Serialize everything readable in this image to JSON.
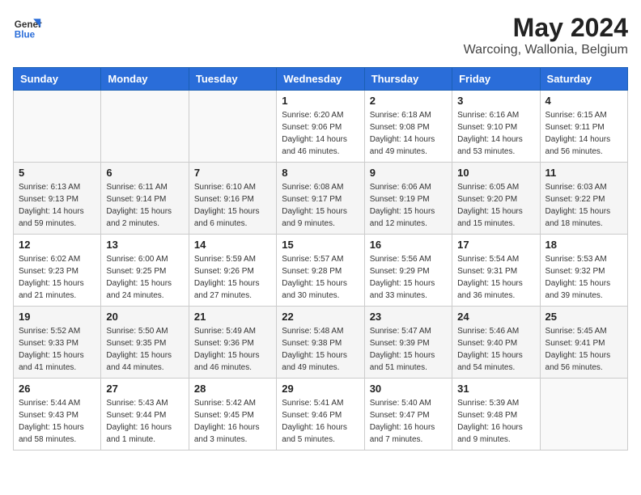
{
  "header": {
    "logo_line1": "General",
    "logo_line2": "Blue",
    "main_title": "May 2024",
    "subtitle": "Warcoing, Wallonia, Belgium"
  },
  "calendar": {
    "headers": [
      "Sunday",
      "Monday",
      "Tuesday",
      "Wednesday",
      "Thursday",
      "Friday",
      "Saturday"
    ],
    "weeks": [
      [
        {
          "day": "",
          "sunrise": "",
          "sunset": "",
          "daylight": ""
        },
        {
          "day": "",
          "sunrise": "",
          "sunset": "",
          "daylight": ""
        },
        {
          "day": "",
          "sunrise": "",
          "sunset": "",
          "daylight": ""
        },
        {
          "day": "1",
          "sunrise": "Sunrise: 6:20 AM",
          "sunset": "Sunset: 9:06 PM",
          "daylight": "Daylight: 14 hours and 46 minutes."
        },
        {
          "day": "2",
          "sunrise": "Sunrise: 6:18 AM",
          "sunset": "Sunset: 9:08 PM",
          "daylight": "Daylight: 14 hours and 49 minutes."
        },
        {
          "day": "3",
          "sunrise": "Sunrise: 6:16 AM",
          "sunset": "Sunset: 9:10 PM",
          "daylight": "Daylight: 14 hours and 53 minutes."
        },
        {
          "day": "4",
          "sunrise": "Sunrise: 6:15 AM",
          "sunset": "Sunset: 9:11 PM",
          "daylight": "Daylight: 14 hours and 56 minutes."
        }
      ],
      [
        {
          "day": "5",
          "sunrise": "Sunrise: 6:13 AM",
          "sunset": "Sunset: 9:13 PM",
          "daylight": "Daylight: 14 hours and 59 minutes."
        },
        {
          "day": "6",
          "sunrise": "Sunrise: 6:11 AM",
          "sunset": "Sunset: 9:14 PM",
          "daylight": "Daylight: 15 hours and 2 minutes."
        },
        {
          "day": "7",
          "sunrise": "Sunrise: 6:10 AM",
          "sunset": "Sunset: 9:16 PM",
          "daylight": "Daylight: 15 hours and 6 minutes."
        },
        {
          "day": "8",
          "sunrise": "Sunrise: 6:08 AM",
          "sunset": "Sunset: 9:17 PM",
          "daylight": "Daylight: 15 hours and 9 minutes."
        },
        {
          "day": "9",
          "sunrise": "Sunrise: 6:06 AM",
          "sunset": "Sunset: 9:19 PM",
          "daylight": "Daylight: 15 hours and 12 minutes."
        },
        {
          "day": "10",
          "sunrise": "Sunrise: 6:05 AM",
          "sunset": "Sunset: 9:20 PM",
          "daylight": "Daylight: 15 hours and 15 minutes."
        },
        {
          "day": "11",
          "sunrise": "Sunrise: 6:03 AM",
          "sunset": "Sunset: 9:22 PM",
          "daylight": "Daylight: 15 hours and 18 minutes."
        }
      ],
      [
        {
          "day": "12",
          "sunrise": "Sunrise: 6:02 AM",
          "sunset": "Sunset: 9:23 PM",
          "daylight": "Daylight: 15 hours and 21 minutes."
        },
        {
          "day": "13",
          "sunrise": "Sunrise: 6:00 AM",
          "sunset": "Sunset: 9:25 PM",
          "daylight": "Daylight: 15 hours and 24 minutes."
        },
        {
          "day": "14",
          "sunrise": "Sunrise: 5:59 AM",
          "sunset": "Sunset: 9:26 PM",
          "daylight": "Daylight: 15 hours and 27 minutes."
        },
        {
          "day": "15",
          "sunrise": "Sunrise: 5:57 AM",
          "sunset": "Sunset: 9:28 PM",
          "daylight": "Daylight: 15 hours and 30 minutes."
        },
        {
          "day": "16",
          "sunrise": "Sunrise: 5:56 AM",
          "sunset": "Sunset: 9:29 PM",
          "daylight": "Daylight: 15 hours and 33 minutes."
        },
        {
          "day": "17",
          "sunrise": "Sunrise: 5:54 AM",
          "sunset": "Sunset: 9:31 PM",
          "daylight": "Daylight: 15 hours and 36 minutes."
        },
        {
          "day": "18",
          "sunrise": "Sunrise: 5:53 AM",
          "sunset": "Sunset: 9:32 PM",
          "daylight": "Daylight: 15 hours and 39 minutes."
        }
      ],
      [
        {
          "day": "19",
          "sunrise": "Sunrise: 5:52 AM",
          "sunset": "Sunset: 9:33 PM",
          "daylight": "Daylight: 15 hours and 41 minutes."
        },
        {
          "day": "20",
          "sunrise": "Sunrise: 5:50 AM",
          "sunset": "Sunset: 9:35 PM",
          "daylight": "Daylight: 15 hours and 44 minutes."
        },
        {
          "day": "21",
          "sunrise": "Sunrise: 5:49 AM",
          "sunset": "Sunset: 9:36 PM",
          "daylight": "Daylight: 15 hours and 46 minutes."
        },
        {
          "day": "22",
          "sunrise": "Sunrise: 5:48 AM",
          "sunset": "Sunset: 9:38 PM",
          "daylight": "Daylight: 15 hours and 49 minutes."
        },
        {
          "day": "23",
          "sunrise": "Sunrise: 5:47 AM",
          "sunset": "Sunset: 9:39 PM",
          "daylight": "Daylight: 15 hours and 51 minutes."
        },
        {
          "day": "24",
          "sunrise": "Sunrise: 5:46 AM",
          "sunset": "Sunset: 9:40 PM",
          "daylight": "Daylight: 15 hours and 54 minutes."
        },
        {
          "day": "25",
          "sunrise": "Sunrise: 5:45 AM",
          "sunset": "Sunset: 9:41 PM",
          "daylight": "Daylight: 15 hours and 56 minutes."
        }
      ],
      [
        {
          "day": "26",
          "sunrise": "Sunrise: 5:44 AM",
          "sunset": "Sunset: 9:43 PM",
          "daylight": "Daylight: 15 hours and 58 minutes."
        },
        {
          "day": "27",
          "sunrise": "Sunrise: 5:43 AM",
          "sunset": "Sunset: 9:44 PM",
          "daylight": "Daylight: 16 hours and 1 minute."
        },
        {
          "day": "28",
          "sunrise": "Sunrise: 5:42 AM",
          "sunset": "Sunset: 9:45 PM",
          "daylight": "Daylight: 16 hours and 3 minutes."
        },
        {
          "day": "29",
          "sunrise": "Sunrise: 5:41 AM",
          "sunset": "Sunset: 9:46 PM",
          "daylight": "Daylight: 16 hours and 5 minutes."
        },
        {
          "day": "30",
          "sunrise": "Sunrise: 5:40 AM",
          "sunset": "Sunset: 9:47 PM",
          "daylight": "Daylight: 16 hours and 7 minutes."
        },
        {
          "day": "31",
          "sunrise": "Sunrise: 5:39 AM",
          "sunset": "Sunset: 9:48 PM",
          "daylight": "Daylight: 16 hours and 9 minutes."
        },
        {
          "day": "",
          "sunrise": "",
          "sunset": "",
          "daylight": ""
        }
      ]
    ]
  }
}
